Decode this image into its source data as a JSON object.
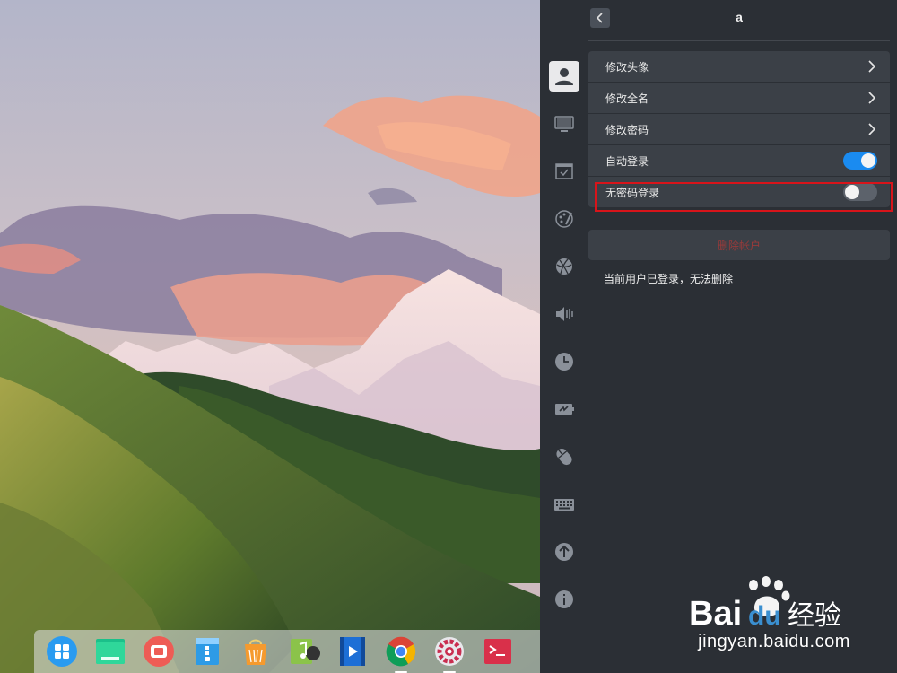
{
  "account": {
    "username": "a"
  },
  "settings": {
    "rows": [
      {
        "label": "修改头像",
        "type": "link"
      },
      {
        "label": "修改全名",
        "type": "link"
      },
      {
        "label": "修改密码",
        "type": "link"
      },
      {
        "label": "自动登录",
        "type": "toggle",
        "enabled": true
      },
      {
        "label": "无密码登录",
        "type": "toggle",
        "enabled": false
      }
    ],
    "delete_label": "删除帐户",
    "delete_note": "当前用户已登录，无法删除"
  },
  "sidebar": {
    "icons": [
      "accounts-icon",
      "display-icon",
      "default-apps-icon",
      "personalization-icon",
      "network-icon",
      "sound-icon",
      "datetime-icon",
      "power-icon",
      "mouse-icon",
      "keyboard-icon",
      "update-icon",
      "info-icon"
    ],
    "active": "accounts-icon"
  },
  "dock": {
    "apps": [
      "launcher-icon",
      "file-manager-icon",
      "screen-recorder-icon",
      "archive-manager-icon",
      "app-store-icon",
      "music-icon",
      "video-icon",
      "chrome-icon",
      "settings-icon",
      "terminal-icon"
    ]
  },
  "watermark": {
    "brand": "Baidu经验",
    "url": "jingyan.baidu.com"
  },
  "colors": {
    "panel_bg": "#2b2f35",
    "row_bg": "#3b4047",
    "toggle_on": "#1a8bf0",
    "highlight": "#d8141a"
  }
}
